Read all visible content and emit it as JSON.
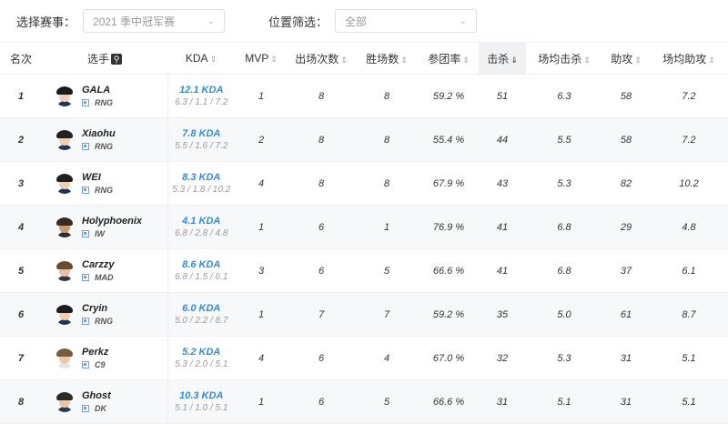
{
  "filters": {
    "season_label": "选择赛事：",
    "season_value": "2021 季中冠军赛",
    "position_label": "位置筛选：",
    "position_value": "全部"
  },
  "columns": {
    "rank": "名次",
    "player": "选手",
    "kda": "KDA",
    "mvp": "MVP",
    "games": "出场次数",
    "wins": "胜场数",
    "kp": "参团率",
    "kills": "击杀",
    "avg_kills": "场均击杀",
    "assists": "助攻",
    "avg_assists": "场均助攻"
  },
  "rows": [
    {
      "rank": "1",
      "name": "GALA",
      "team": "RNG",
      "kda": "12.1 KDA",
      "kda_detail": "6.3 / 1.1 / 7.2",
      "mvp": "1",
      "games": "8",
      "wins": "8",
      "kp": "59.2 %",
      "kills": "51",
      "avg_kills": "6.3",
      "assists": "58",
      "avg_assists": "7.2"
    },
    {
      "rank": "2",
      "name": "Xiaohu",
      "team": "RNG",
      "kda": "7.8 KDA",
      "kda_detail": "5.5 / 1.6 / 7.2",
      "mvp": "2",
      "games": "8",
      "wins": "8",
      "kp": "55.4 %",
      "kills": "44",
      "avg_kills": "5.5",
      "assists": "58",
      "avg_assists": "7.2"
    },
    {
      "rank": "3",
      "name": "WEI",
      "team": "RNG",
      "kda": "8.3 KDA",
      "kda_detail": "5.3 / 1.8 / 10.2",
      "mvp": "4",
      "games": "8",
      "wins": "8",
      "kp": "67.9 %",
      "kills": "43",
      "avg_kills": "5.3",
      "assists": "82",
      "avg_assists": "10.2"
    },
    {
      "rank": "4",
      "name": "Holyphoenix",
      "team": "IW",
      "kda": "4.1 KDA",
      "kda_detail": "6.8 / 2.8 / 4.8",
      "mvp": "1",
      "games": "6",
      "wins": "1",
      "kp": "76.9 %",
      "kills": "41",
      "avg_kills": "6.8",
      "assists": "29",
      "avg_assists": "4.8"
    },
    {
      "rank": "5",
      "name": "Carzzy",
      "team": "MAD",
      "kda": "8.6 KDA",
      "kda_detail": "6.8 / 1.5 / 6.1",
      "mvp": "3",
      "games": "6",
      "wins": "5",
      "kp": "66.6 %",
      "kills": "41",
      "avg_kills": "6.8",
      "assists": "37",
      "avg_assists": "6.1"
    },
    {
      "rank": "6",
      "name": "Cryin",
      "team": "RNG",
      "kda": "6.0 KDA",
      "kda_detail": "5.0 / 2.2 / 8.7",
      "mvp": "1",
      "games": "7",
      "wins": "7",
      "kp": "59.2 %",
      "kills": "35",
      "avg_kills": "5.0",
      "assists": "61",
      "avg_assists": "8.7"
    },
    {
      "rank": "7",
      "name": "Perkz",
      "team": "C9",
      "kda": "5.2 KDA",
      "kda_detail": "5.3 / 2.0 / 5.1",
      "mvp": "4",
      "games": "6",
      "wins": "4",
      "kp": "67.0 %",
      "kills": "32",
      "avg_kills": "5.3",
      "assists": "31",
      "avg_assists": "5.1"
    },
    {
      "rank": "8",
      "name": "Ghost",
      "team": "DK",
      "kda": "10.3 KDA",
      "kda_detail": "5.1 / 1.0 / 5.1",
      "mvp": "1",
      "games": "6",
      "wins": "5",
      "kp": "66.6 %",
      "kills": "31",
      "avg_kills": "5.1",
      "assists": "31",
      "avg_assists": "5.1"
    }
  ],
  "avatar_colors": [
    {
      "hair": "#1b1b1b",
      "face": "#f1d2b8",
      "body": "#1f3557"
    },
    {
      "hair": "#222222",
      "face": "#efcfb3",
      "body": "#1f3557"
    },
    {
      "hair": "#202020",
      "face": "#f0cfb0",
      "body": "#1f3557"
    },
    {
      "hair": "#3a2a1e",
      "face": "#c99a76",
      "body": "#2b2b2b"
    },
    {
      "hair": "#6b4a2f",
      "face": "#e8c3a3",
      "body": "#33363d"
    },
    {
      "hair": "#1d1d1d",
      "face": "#f0cfb3",
      "body": "#1f3557"
    },
    {
      "hair": "#7a5a3c",
      "face": "#edc9aa",
      "body": "#dfe6ee"
    },
    {
      "hair": "#2a2a2a",
      "face": "#e9c6a6",
      "body": "#2c3a4f"
    }
  ],
  "icons": {
    "dropdown": "chevron-down-icon",
    "player_search": "search-icon",
    "role": "role-icon"
  },
  "colors": {
    "kda_accent": "#2b8de0",
    "active_header_bg": "#f0f1f3"
  }
}
